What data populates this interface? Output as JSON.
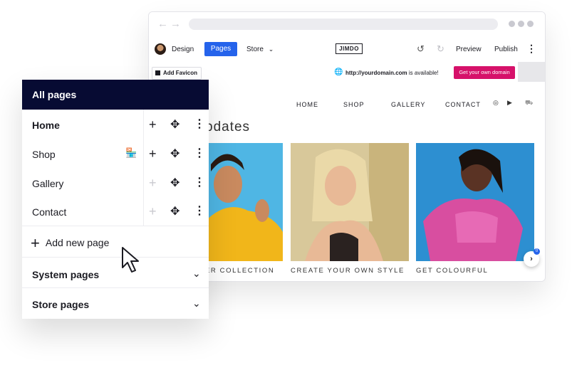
{
  "browser": {
    "nav_back": "←",
    "nav_forward": "→"
  },
  "toolbar": {
    "design": "Design",
    "pages": "Pages",
    "store": "Store",
    "logo": "JIMDO",
    "preview": "Preview",
    "publish": "Publish"
  },
  "notice": {
    "add_favicon": "Add Favicon",
    "domain": "http://yourdomain.com",
    "available_text": " is available!",
    "cta": "Get your own domain"
  },
  "site": {
    "nav": [
      "HOME",
      "SHOP",
      "GALLERY",
      "CONTACT"
    ],
    "heading_fragment": "pdates",
    "captions": [
      "ER COLLECTION",
      "CREATE YOUR OWN STYLE",
      "GET COLOURFUL"
    ],
    "next_badge": "0",
    "photo_colors": [
      "#4fb6e4",
      "#d8c89a",
      "#2d8fd1"
    ]
  },
  "panel": {
    "title": "All pages",
    "pages": [
      {
        "label": "Home",
        "bold": true
      },
      {
        "label": "Shop",
        "bold": false
      },
      {
        "label": "Gallery",
        "bold": false
      },
      {
        "label": "Contact",
        "bold": false
      }
    ],
    "add_new_page": "Add new page",
    "system_pages": "System pages",
    "store_pages": "Store pages"
  },
  "colors": {
    "panel_header": "#070b33",
    "pages_button": "#2563eb",
    "domain_cta": "#d6116a"
  }
}
